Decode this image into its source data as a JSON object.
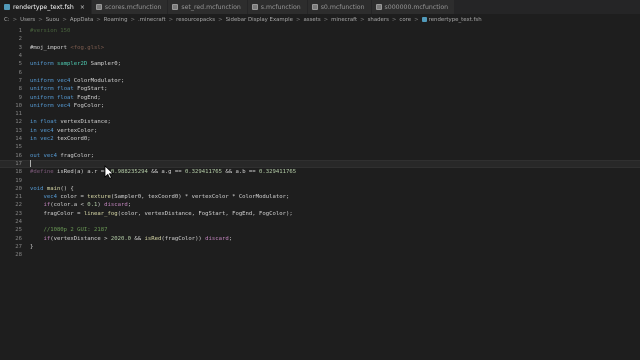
{
  "tabs": [
    {
      "label": "rendertype_text.fsh",
      "active": true,
      "icon": "shader-file-icon"
    },
    {
      "label": "scores.mcfunction",
      "active": false,
      "icon": "mcfunction-file-icon"
    },
    {
      "label": "set_red.mcfunction",
      "active": false,
      "icon": "mcfunction-file-icon"
    },
    {
      "label": "s.mcfunction",
      "active": false,
      "icon": "mcfunction-file-icon"
    },
    {
      "label": "s0.mcfunction",
      "active": false,
      "icon": "mcfunction-file-icon"
    },
    {
      "label": "s000000.mcfunction",
      "active": false,
      "icon": "mcfunction-file-icon"
    }
  ],
  "tab_close_glyph": "×",
  "breadcrumb": [
    "C:",
    "Users",
    "Suou",
    "AppData",
    "Roaming",
    ".minecraft",
    "resourcepacks",
    "Sidebar Display Example",
    "assets",
    "minecraft",
    "shaders",
    "core",
    "rendertype_text.fsh"
  ],
  "breadcrumb_separator": ">",
  "editor": {
    "current_line": 17,
    "lines": [
      {
        "n": "1",
        "tokens": [
          {
            "t": "#version 150",
            "c": "t-comment dim"
          }
        ]
      },
      {
        "n": "2",
        "tokens": []
      },
      {
        "n": "3",
        "tokens": [
          {
            "t": "#moj_import ",
            "c": "t-plain"
          },
          {
            "t": "<fog.glsl>",
            "c": "t-str dim"
          }
        ]
      },
      {
        "n": "4",
        "tokens": []
      },
      {
        "n": "5",
        "tokens": [
          {
            "t": "uniform ",
            "c": "t-kw"
          },
          {
            "t": "sampler2D ",
            "c": "t-type"
          },
          {
            "t": "Sampler0;",
            "c": "t-plain"
          }
        ]
      },
      {
        "n": "6",
        "tokens": []
      },
      {
        "n": "7",
        "tokens": [
          {
            "t": "uniform ",
            "c": "t-kw"
          },
          {
            "t": "vec4 ",
            "c": "t-kw"
          },
          {
            "t": "ColorModulator;",
            "c": "t-plain"
          }
        ]
      },
      {
        "n": "8",
        "tokens": [
          {
            "t": "uniform ",
            "c": "t-kw"
          },
          {
            "t": "float ",
            "c": "t-kw"
          },
          {
            "t": "FogStart;",
            "c": "t-plain"
          }
        ]
      },
      {
        "n": "9",
        "tokens": [
          {
            "t": "uniform ",
            "c": "t-kw"
          },
          {
            "t": "float ",
            "c": "t-kw"
          },
          {
            "t": "FogEnd;",
            "c": "t-plain"
          }
        ]
      },
      {
        "n": "10",
        "tokens": [
          {
            "t": "uniform ",
            "c": "t-kw"
          },
          {
            "t": "vec4 ",
            "c": "t-kw"
          },
          {
            "t": "FogColor;",
            "c": "t-plain"
          }
        ]
      },
      {
        "n": "11",
        "tokens": []
      },
      {
        "n": "12",
        "tokens": [
          {
            "t": "in ",
            "c": "t-kw"
          },
          {
            "t": "float ",
            "c": "t-kw"
          },
          {
            "t": "vertexDistance;",
            "c": "t-plain"
          }
        ]
      },
      {
        "n": "13",
        "tokens": [
          {
            "t": "in ",
            "c": "t-kw"
          },
          {
            "t": "vec4 ",
            "c": "t-kw"
          },
          {
            "t": "vertexColor;",
            "c": "t-plain"
          }
        ]
      },
      {
        "n": "14",
        "tokens": [
          {
            "t": "in ",
            "c": "t-kw"
          },
          {
            "t": "vec2 ",
            "c": "t-kw"
          },
          {
            "t": "texCoord0;",
            "c": "t-plain"
          }
        ]
      },
      {
        "n": "15",
        "tokens": []
      },
      {
        "n": "16",
        "tokens": [
          {
            "t": "out ",
            "c": "t-kw"
          },
          {
            "t": "vec4 ",
            "c": "t-kw"
          },
          {
            "t": "fragColor;",
            "c": "t-plain"
          }
        ]
      },
      {
        "n": "17",
        "tokens": []
      },
      {
        "n": "18",
        "tokens": [
          {
            "t": "#define ",
            "c": "t-ctrl dim"
          },
          {
            "t": "isRed(a) a.r ",
            "c": "t-plain"
          },
          {
            "t": "== ",
            "c": "t-plain"
          },
          {
            "t": "0.988235294",
            "c": "t-num"
          },
          {
            "t": " && a.g == ",
            "c": "t-plain"
          },
          {
            "t": "0.329411765",
            "c": "t-num"
          },
          {
            "t": " && a.b == ",
            "c": "t-plain"
          },
          {
            "t": "0.329411765",
            "c": "t-num"
          }
        ]
      },
      {
        "n": "19",
        "tokens": []
      },
      {
        "n": "20",
        "tokens": [
          {
            "t": "void ",
            "c": "t-kw"
          },
          {
            "t": "main",
            "c": "t-fn"
          },
          {
            "t": "() {",
            "c": "t-plain"
          }
        ]
      },
      {
        "n": "21",
        "tokens": [
          {
            "t": "    vec4 ",
            "c": "t-kw"
          },
          {
            "t": "color = ",
            "c": "t-plain"
          },
          {
            "t": "texture",
            "c": "t-fn"
          },
          {
            "t": "(Sampler0, texCoord0) * vertexColor * ColorModulator;",
            "c": "t-plain"
          }
        ]
      },
      {
        "n": "22",
        "tokens": [
          {
            "t": "    if",
            "c": "t-ctrl"
          },
          {
            "t": "(color.a < ",
            "c": "t-plain"
          },
          {
            "t": "0.1",
            "c": "t-num"
          },
          {
            "t": ") ",
            "c": "t-plain"
          },
          {
            "t": "discard",
            "c": "t-ctrl"
          },
          {
            "t": ";",
            "c": "t-plain"
          }
        ]
      },
      {
        "n": "23",
        "tokens": [
          {
            "t": "    fragColor = ",
            "c": "t-plain"
          },
          {
            "t": "linear_fog",
            "c": "t-fn"
          },
          {
            "t": "(color, vertexDistance, FogStart, FogEnd, FogColor);",
            "c": "t-plain"
          }
        ]
      },
      {
        "n": "24",
        "tokens": []
      },
      {
        "n": "25",
        "tokens": [
          {
            "t": "    //1080p 2 GUI: 2187",
            "c": "t-comment"
          }
        ]
      },
      {
        "n": "26",
        "tokens": [
          {
            "t": "    if",
            "c": "t-ctrl"
          },
          {
            "t": "(vertexDistance > ",
            "c": "t-plain"
          },
          {
            "t": "2020.0",
            "c": "t-num"
          },
          {
            "t": " && ",
            "c": "t-plain"
          },
          {
            "t": "isRed",
            "c": "t-fn"
          },
          {
            "t": "(fragColor)) ",
            "c": "t-plain"
          },
          {
            "t": "discard",
            "c": "t-ctrl"
          },
          {
            "t": ";",
            "c": "t-plain"
          }
        ]
      },
      {
        "n": "27",
        "tokens": [
          {
            "t": "}",
            "c": "t-plain"
          }
        ]
      },
      {
        "n": "28",
        "tokens": []
      }
    ]
  }
}
